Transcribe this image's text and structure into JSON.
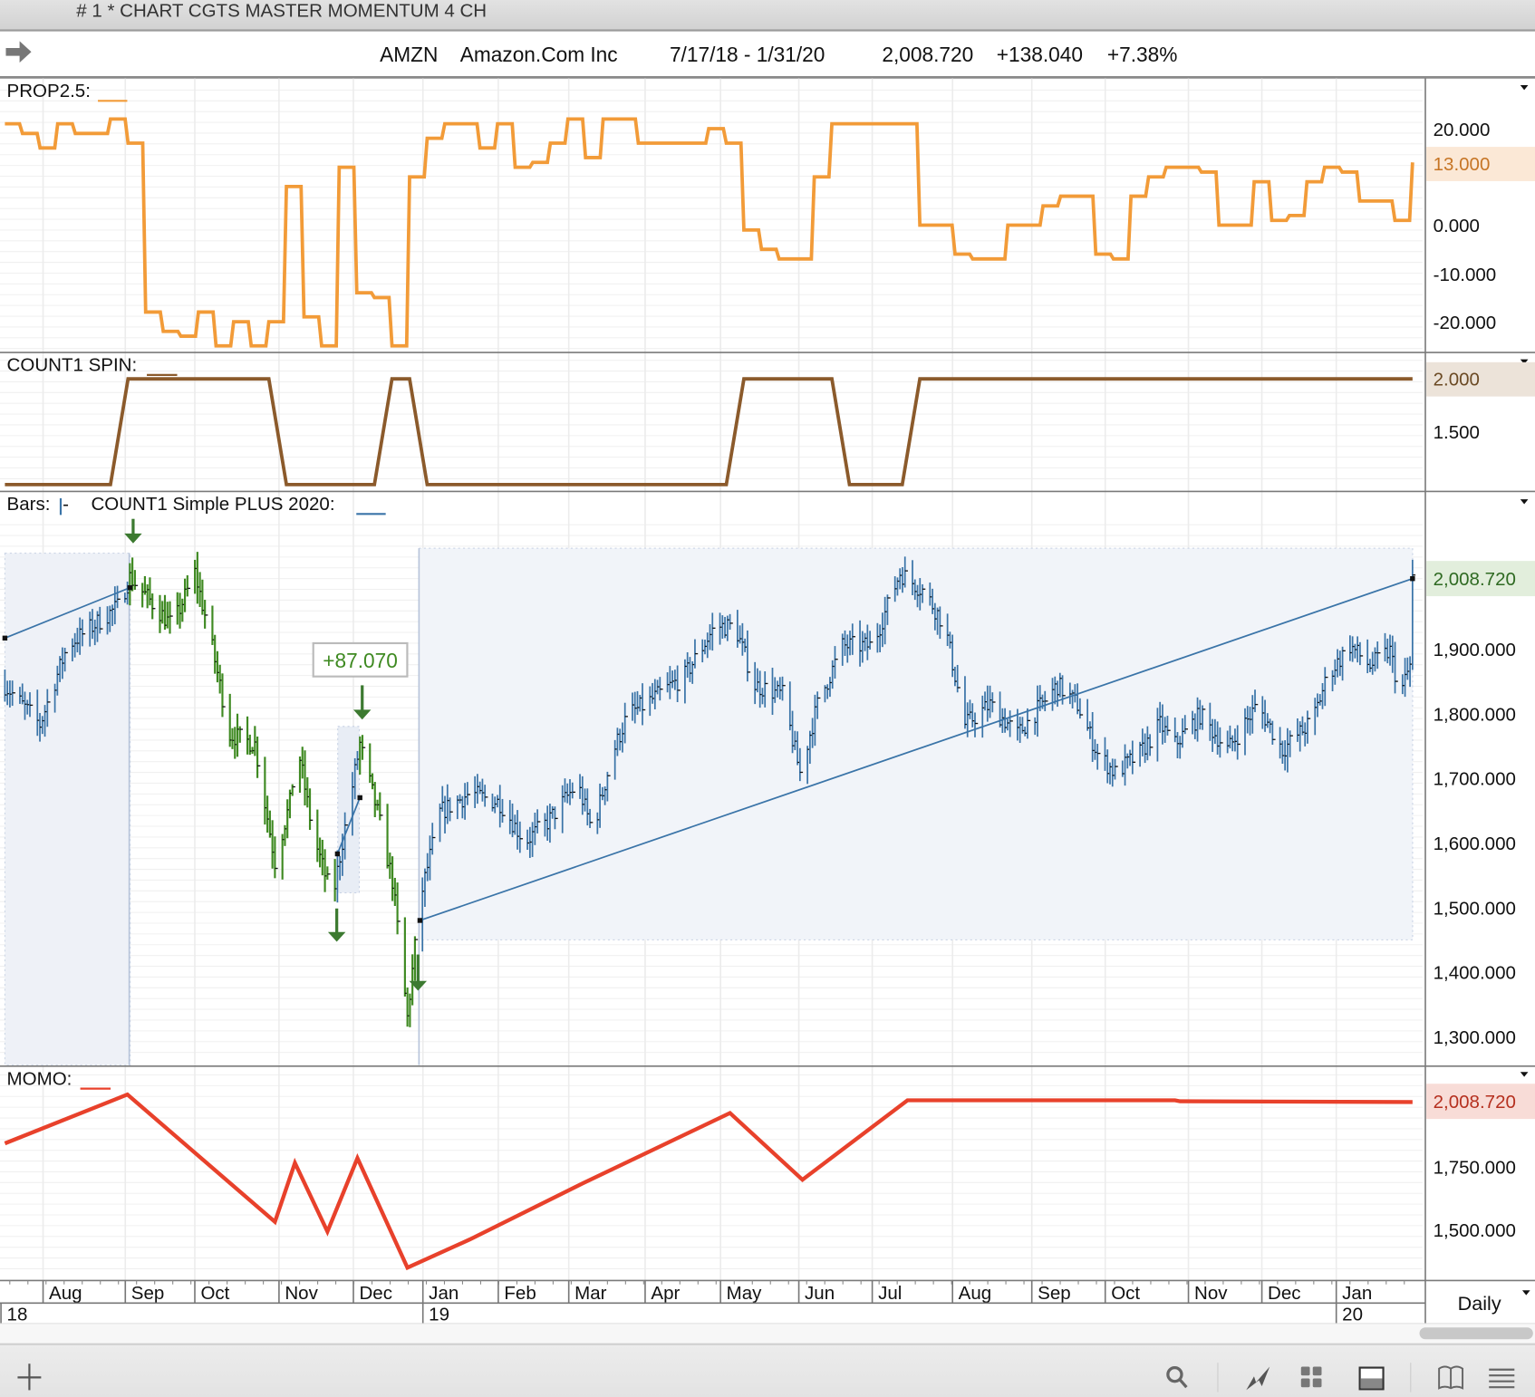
{
  "window": {
    "title": "# 1 * CHART CGTS MASTER MOMENTUM 4 CH"
  },
  "header": {
    "symbol": "AMZN",
    "company": "Amazon.Com Inc",
    "date_range": "7/17/18 - 1/31/20",
    "last": "2,008.720",
    "change": "+138.040",
    "change_pct": "+7.38%"
  },
  "panels": {
    "prop": {
      "label": "PROP2.5:",
      "current": "13.000",
      "ticks": [
        "20.000",
        "0.000",
        "-10.000",
        "-20.000"
      ]
    },
    "spin": {
      "label": "COUNT1 SPIN:",
      "current": "2.000",
      "ticks": [
        "1.500"
      ]
    },
    "price": {
      "label_bars": "Bars:",
      "label_study": "COUNT1 Simple PLUS 2020:",
      "current": "2,008.720",
      "ticks": [
        "1,900.000",
        "1,800.000",
        "1,700.000",
        "1,600.000",
        "1,500.000",
        "1,400.000",
        "1,300.000"
      ],
      "annotation": "+87.070"
    },
    "momo": {
      "label": "MOMO:",
      "current": "2,008.720",
      "ticks": [
        "1,750.000",
        "1,500.000"
      ]
    }
  },
  "xaxis": {
    "months": [
      "Aug",
      "Sep",
      "Oct",
      "Nov",
      "Dec",
      "Jan",
      "Feb",
      "Mar",
      "Apr",
      "May",
      "Jun",
      "Jul",
      "Aug",
      "Sep",
      "Oct",
      "Nov",
      "Dec",
      "Jan"
    ],
    "years": [
      "18",
      "19",
      "20"
    ],
    "period": "Daily"
  },
  "colors": {
    "prop": "#f29b38",
    "spin": "#8b5a2b",
    "up_bars": "#3a74a8",
    "down_bars": "#3f8a22",
    "momo": "#e8412b",
    "arrow": "#3c7a30"
  },
  "chart_data": [
    {
      "type": "line",
      "name": "PROP2.5",
      "start": "2018-07-17",
      "end": "2020-01-31",
      "ylim": [
        -25,
        23
      ],
      "values": [
        21,
        19,
        16,
        21,
        19,
        19,
        22,
        17,
        -18,
        -22,
        -23,
        -18,
        -25,
        -20,
        -25,
        -20,
        8,
        -19,
        -25,
        12,
        -14,
        -15,
        -25,
        10,
        18,
        21,
        21,
        16,
        21,
        12,
        13,
        17,
        22,
        14,
        22,
        22,
        17,
        17,
        17,
        17,
        20,
        17,
        -1,
        -5,
        -7,
        -7,
        10,
        21,
        21,
        21,
        21,
        21,
        0,
        0,
        -6,
        -7,
        -7,
        0,
        0,
        4,
        6,
        6,
        -6,
        -7,
        6,
        10,
        12,
        12,
        11,
        0,
        0,
        9,
        1,
        2,
        9,
        12,
        11,
        5,
        5,
        1,
        13
      ]
    },
    {
      "type": "line",
      "name": "COUNT1 SPIN",
      "start": "2018-07-17",
      "end": "2020-01-31",
      "ylim": [
        1,
        2
      ],
      "values": [
        1,
        1,
        1,
        1,
        1,
        1,
        1,
        2,
        2,
        2,
        2,
        2,
        2,
        2,
        2,
        2,
        1,
        1,
        1,
        1,
        1,
        1,
        2,
        2,
        1,
        1,
        1,
        1,
        1,
        1,
        1,
        1,
        1,
        1,
        1,
        1,
        1,
        1,
        1,
        1,
        1,
        1,
        2,
        2,
        2,
        2,
        2,
        2,
        1,
        1,
        1,
        1,
        2,
        2,
        2,
        2,
        2,
        2,
        2,
        2,
        2,
        2,
        2,
        2,
        2,
        2,
        2,
        2,
        2,
        2,
        2,
        2,
        2,
        2,
        2,
        2,
        2,
        2,
        2,
        2,
        2
      ]
    },
    {
      "type": "bar",
      "name": "AMZN price (OHLC)",
      "ylim": [
        1270,
        2080
      ],
      "waypoints_day_offset": [
        [
          0,
          1844
        ],
        [
          14,
          1783
        ],
        [
          25,
          1905
        ],
        [
          45,
          1965
        ],
        [
          50,
          2011
        ],
        [
          57,
          1980
        ],
        [
          67,
          1935
        ],
        [
          76,
          2018
        ],
        [
          82,
          1920
        ],
        [
          90,
          1768
        ],
        [
          100,
          1753
        ],
        [
          108,
          1571
        ],
        [
          114,
          1662
        ],
        [
          117,
          1753
        ],
        [
          123,
          1617
        ],
        [
          131,
          1511
        ],
        [
          135,
          1602
        ],
        [
          142,
          1753
        ],
        [
          149,
          1647
        ],
        [
          155,
          1541
        ],
        [
          161,
          1329
        ],
        [
          166,
          1511
        ],
        [
          174,
          1647
        ],
        [
          186,
          1677
        ],
        [
          198,
          1662
        ],
        [
          208,
          1602
        ],
        [
          217,
          1632
        ],
        [
          229,
          1692
        ],
        [
          235,
          1617
        ],
        [
          243,
          1738
        ],
        [
          249,
          1798
        ],
        [
          256,
          1814
        ],
        [
          272,
          1859
        ],
        [
          284,
          1935
        ],
        [
          292,
          1935
        ],
        [
          300,
          1844
        ],
        [
          311,
          1829
        ],
        [
          318,
          1708
        ],
        [
          325,
          1814
        ],
        [
          335,
          1905
        ],
        [
          347,
          1905
        ],
        [
          358,
          2018
        ],
        [
          368,
          1988
        ],
        [
          376,
          1935
        ],
        [
          384,
          1783
        ],
        [
          394,
          1814
        ],
        [
          405,
          1768
        ],
        [
          421,
          1844
        ],
        [
          429,
          1814
        ],
        [
          437,
          1738
        ],
        [
          444,
          1708
        ],
        [
          454,
          1738
        ],
        [
          462,
          1783
        ],
        [
          468,
          1753
        ],
        [
          478,
          1798
        ],
        [
          489,
          1744
        ],
        [
          501,
          1814
        ],
        [
          511,
          1744
        ],
        [
          523,
          1789
        ],
        [
          529,
          1859
        ],
        [
          538,
          1905
        ],
        [
          546,
          1874
        ],
        [
          554,
          1897
        ],
        [
          558,
          1829
        ],
        [
          562,
          1874
        ],
        [
          563,
          2009
        ]
      ],
      "green_ranges": [
        [
          50,
          133
        ],
        [
          142,
          166
        ]
      ],
      "regression_lines": [
        [
          [
            0,
            1917
          ],
          [
            50,
            1995
          ]
        ],
        [
          [
            166,
            1480
          ],
          [
            563,
            2009
          ]
        ],
        [
          [
            133,
            1583
          ],
          [
            142,
            1670
          ]
        ]
      ]
    },
    {
      "type": "line",
      "name": "MOMO",
      "ylim": [
        1280,
        2080
      ],
      "points_day_offset": [
        [
          0,
          1844
        ],
        [
          49,
          2039
        ],
        [
          108,
          1531
        ],
        [
          116,
          1766
        ],
        [
          129,
          1492
        ],
        [
          141,
          1785
        ],
        [
          161,
          1348
        ],
        [
          186,
          1461
        ],
        [
          231,
          1684
        ],
        [
          290,
          1965
        ],
        [
          319,
          1699
        ],
        [
          361,
          2016
        ],
        [
          468,
          2016
        ],
        [
          470,
          2012
        ],
        [
          563,
          2009
        ]
      ]
    }
  ]
}
